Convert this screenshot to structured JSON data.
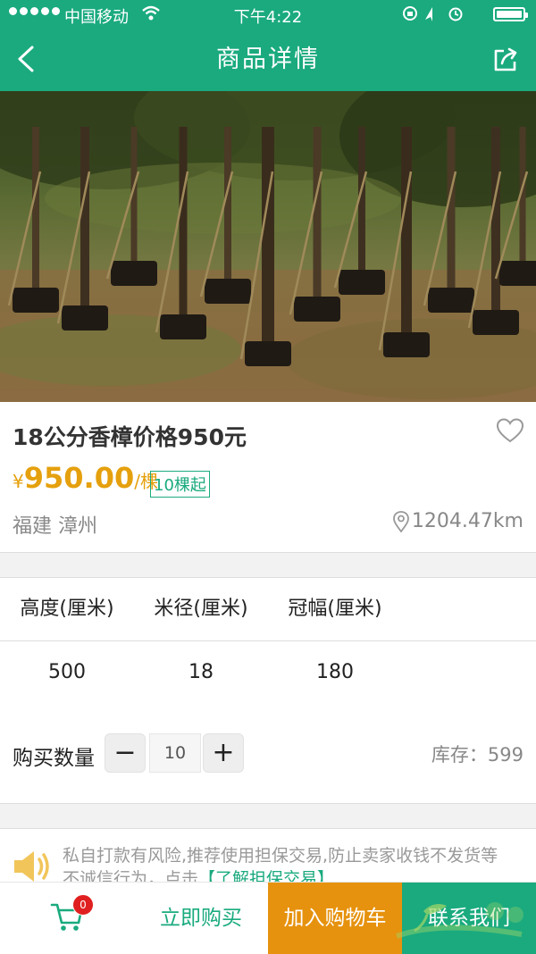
{
  "status_bar": {
    "carrier": "中国移动",
    "time": "下午4:22"
  },
  "nav": {
    "title": "商品详情",
    "back_icon": "chevron-left-icon",
    "share_icon": "share-icon"
  },
  "gallery": {
    "image": "香樟树苗圃照片",
    "slide_count": 3,
    "active_index": 0
  },
  "product": {
    "name": "18公分香樟价格950元",
    "currency": "¥",
    "price": "950.00",
    "unit": "/棵",
    "min_order": "10棵起",
    "location": "福建 漳州",
    "distance": "1204.47km"
  },
  "specs": {
    "headers": [
      "高度(厘米)",
      "米径(厘米)",
      "冠幅(厘米)"
    ],
    "values": [
      "500",
      "18",
      "180"
    ]
  },
  "quantity": {
    "label": "购买数量",
    "minus": "−",
    "value": "10",
    "plus": "+",
    "stock": "库存：599"
  },
  "notice": {
    "text": "私自打款有风险,推荐使用担保交易,防止卖家收钱不发货等不诚信行为，点击",
    "link": "【了解担保交易】"
  },
  "bottom_bar": {
    "cart_badge": "0",
    "buy_now": "立即购买",
    "add_to_cart": "加入购物车",
    "contact": "联系我们"
  },
  "colors": {
    "brand_green": "#1aaa7e",
    "price_orange": "#e5a00d",
    "add_cart_orange": "#e6920e",
    "badge_red": "#e02020"
  }
}
